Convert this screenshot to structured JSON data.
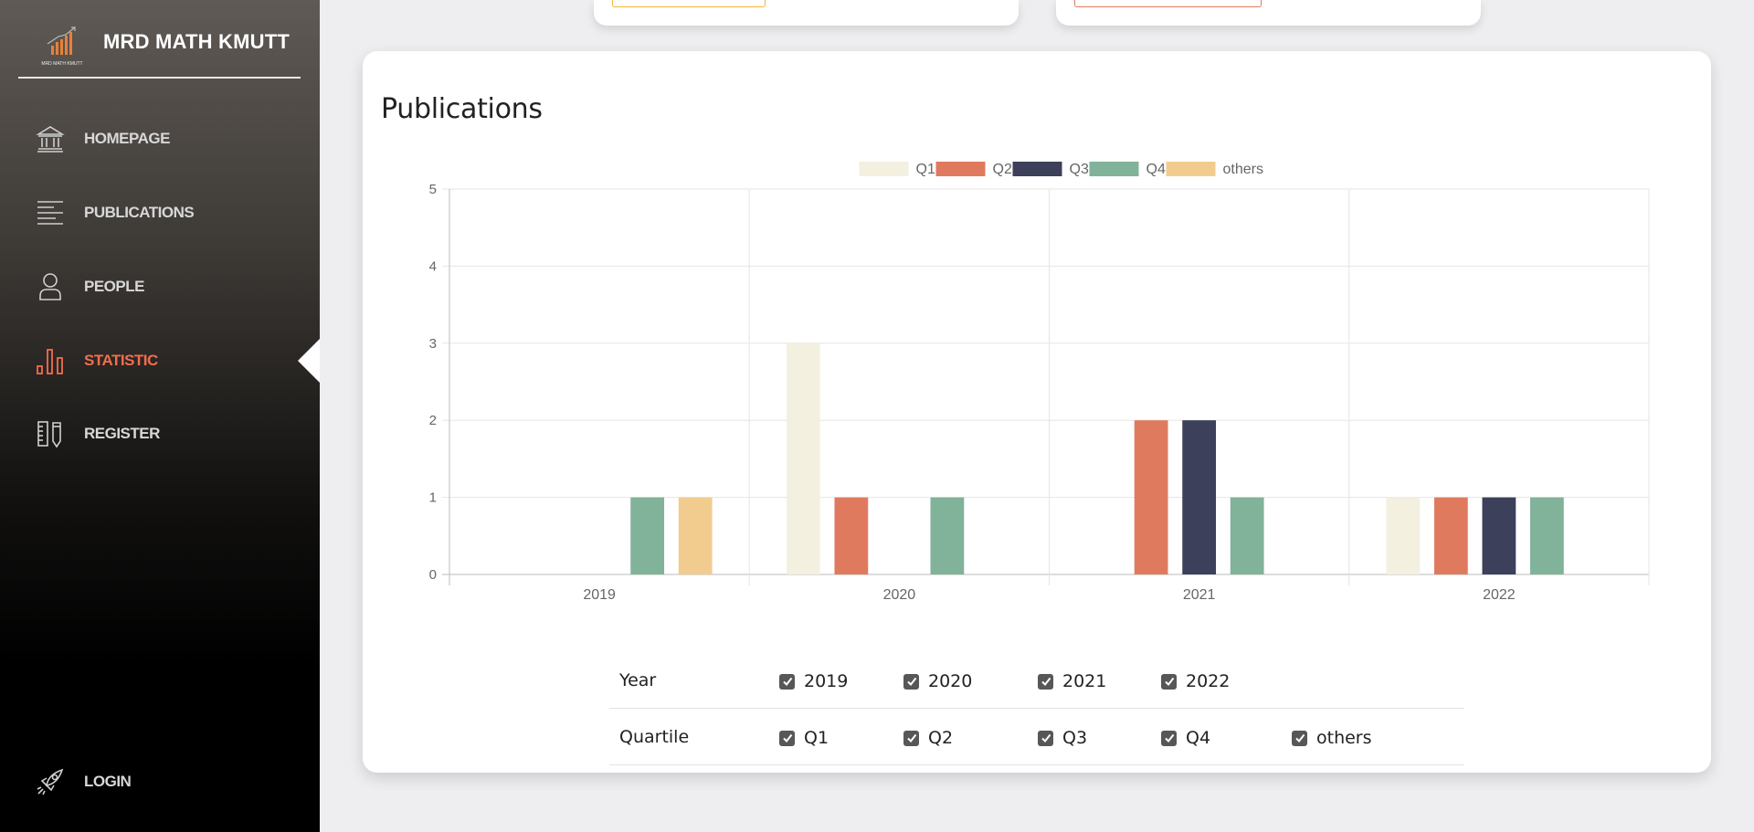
{
  "sidebar": {
    "brand": "MRD MATH KMUTT",
    "logo_text": "MRD MATH KMUTT",
    "items": [
      {
        "label": "HOMEPAGE",
        "icon": "bank-icon"
      },
      {
        "label": "PUBLICATIONS",
        "icon": "text-lines-icon"
      },
      {
        "label": "PEOPLE",
        "icon": "person-icon"
      },
      {
        "label": "STATISTIC",
        "icon": "bar-chart-icon",
        "active": true
      },
      {
        "label": "REGISTER",
        "icon": "ruler-pencil-icon"
      }
    ],
    "login": {
      "label": "LOGIN",
      "icon": "rocket-icon"
    }
  },
  "panel": {
    "title": "Publications"
  },
  "colors": {
    "accent": "#f26d4d",
    "Q1": "#f3f0e0",
    "Q2": "#e07a5f",
    "Q3": "#3d405b",
    "Q4": "#81b29a",
    "others": "#f2cc8f"
  },
  "chart_data": {
    "type": "bar",
    "categories": [
      "2019",
      "2020",
      "2021",
      "2022"
    ],
    "series": [
      {
        "name": "Q1",
        "color": "#f3f0e0",
        "values": [
          0,
          3,
          0,
          1
        ]
      },
      {
        "name": "Q2",
        "color": "#e07a5f",
        "values": [
          0,
          1,
          2,
          1
        ]
      },
      {
        "name": "Q3",
        "color": "#3d405b",
        "values": [
          0,
          0,
          2,
          1
        ]
      },
      {
        "name": "Q4",
        "color": "#81b29a",
        "values": [
          1,
          1,
          1,
          1
        ]
      },
      {
        "name": "others",
        "color": "#f2cc8f",
        "values": [
          1,
          0,
          0,
          0
        ]
      }
    ],
    "yticks": [
      "0",
      "1",
      "2",
      "3",
      "4",
      "5"
    ],
    "ylim": [
      0,
      5
    ],
    "legend": "top-center",
    "grid": true
  },
  "filters": {
    "year": {
      "label": "Year",
      "options": [
        "2019",
        "2020",
        "2021",
        "2022"
      ]
    },
    "quartile": {
      "label": "Quartile",
      "options": [
        "Q1",
        "Q2",
        "Q3",
        "Q4",
        "others"
      ]
    }
  }
}
